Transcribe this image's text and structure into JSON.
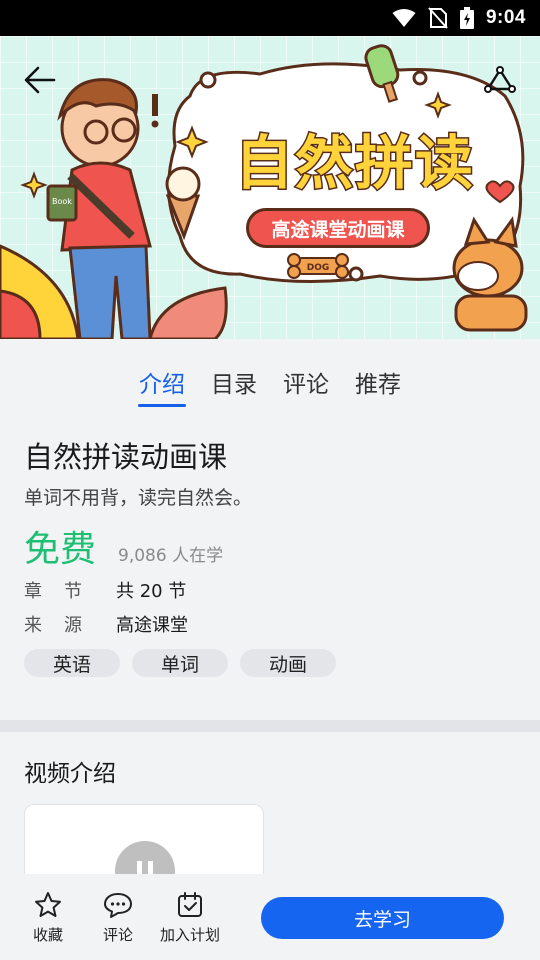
{
  "status_bar": {
    "time": "9:04"
  },
  "banner": {
    "title": "自然拼读",
    "subtitle": "高途课堂动画课",
    "book_label": "Book",
    "dog_bone_label": "DOG"
  },
  "tabs": [
    {
      "label": "介绍",
      "active": true
    },
    {
      "label": "目录",
      "active": false
    },
    {
      "label": "评论",
      "active": false
    },
    {
      "label": "推荐",
      "active": false
    }
  ],
  "course": {
    "title": "自然拼读动画课",
    "subtitle": "单词不用背，读完自然会。",
    "price": "免费",
    "learners": "9,086 人在学",
    "meta": [
      {
        "key": "章节",
        "value": "共 20 节"
      },
      {
        "key": "来源",
        "value": "高途课堂"
      }
    ],
    "tags": [
      "英语",
      "单词",
      "动画"
    ]
  },
  "video_section": {
    "title": "视频介绍"
  },
  "bottom_bar": {
    "favorite_label": "收藏",
    "comment_label": "评论",
    "plan_label": "加入计划",
    "study_label": "去学习"
  },
  "colors": {
    "accent": "#1565f0",
    "price": "#1dbf73",
    "banner_bg": "#d9f6ee"
  }
}
